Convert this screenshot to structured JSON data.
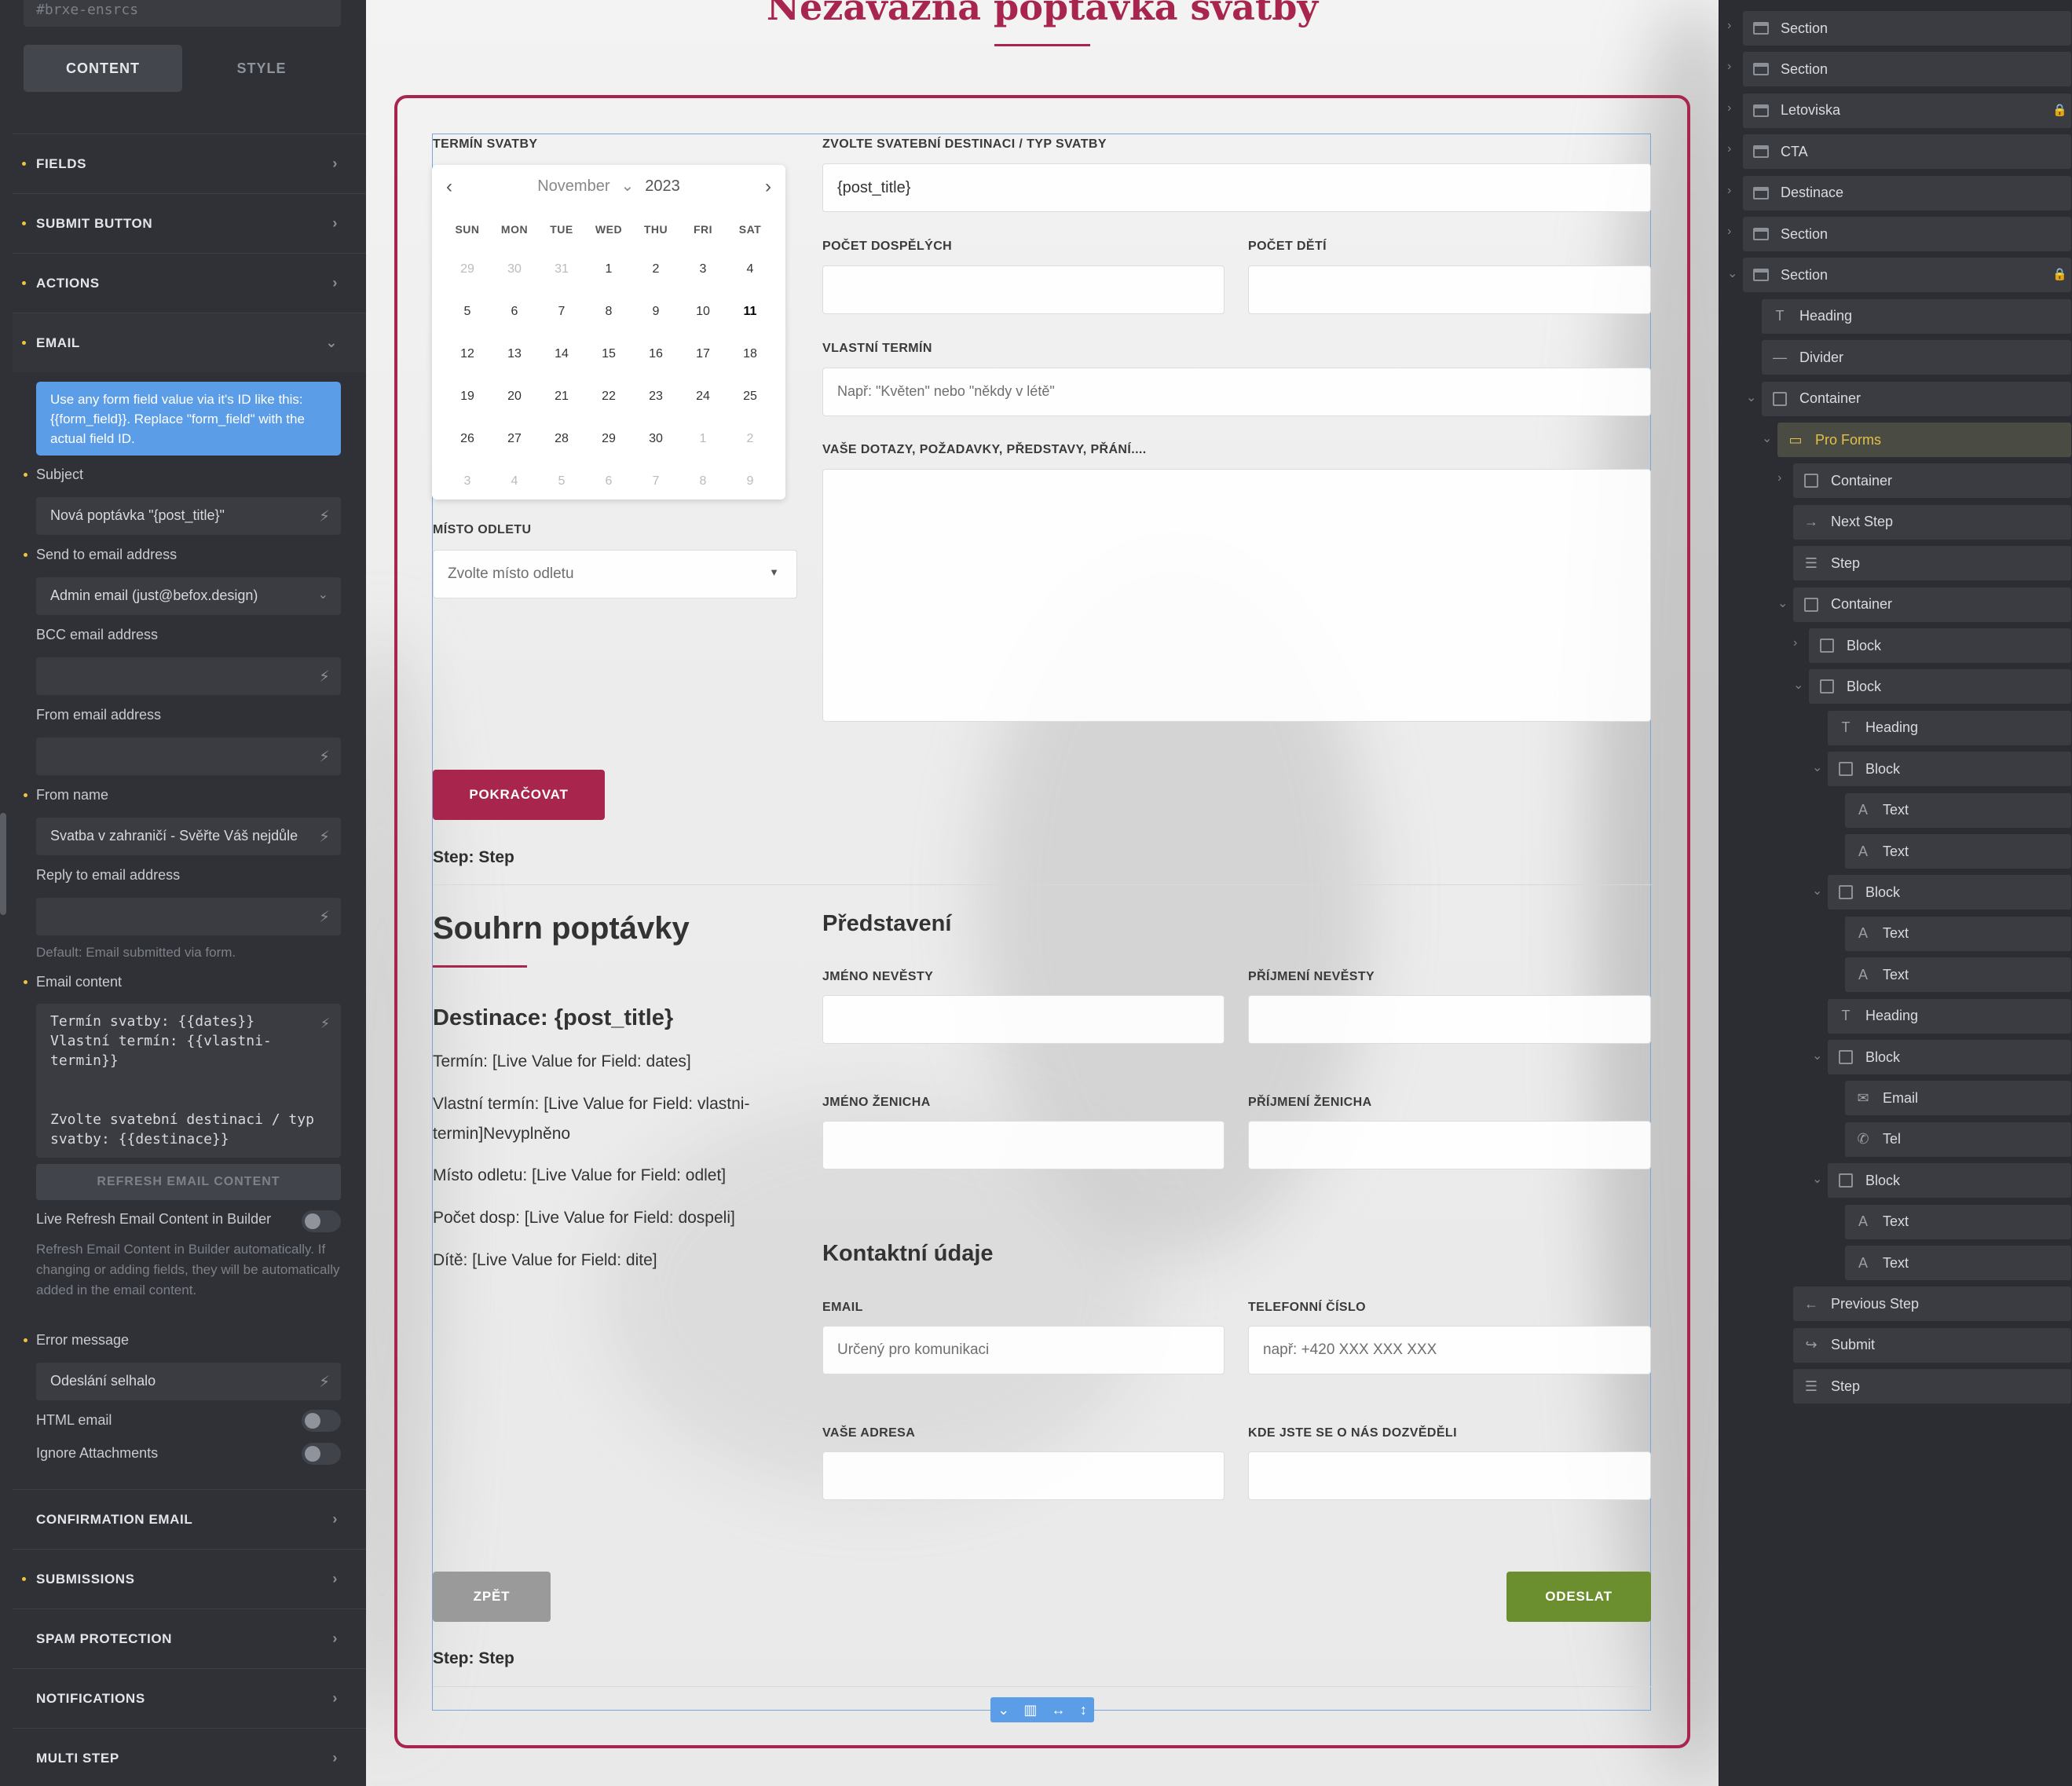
{
  "left_panel": {
    "element_id": "#brxe-ensrcs",
    "tabs": [
      "CONTENT",
      "STYLE"
    ],
    "sections": {
      "fields": "FIELDS",
      "submit_button": "SUBMIT BUTTON",
      "actions": "ACTIONS",
      "email": "EMAIL",
      "confirmation_email": "CONFIRMATION EMAIL",
      "submissions": "SUBMISSIONS",
      "spam_protection": "SPAM PROTECTION",
      "notifications": "NOTIFICATIONS",
      "multi_step": "MULTI STEP"
    },
    "email": {
      "info": "Use any form field value via it's ID like this: {{form_field}}. Replace \"form_field\" with the actual field ID.",
      "subject_label": "Subject",
      "subject_value": "Nová poptávka \"{post_title}\"",
      "send_to_label": "Send to email address",
      "send_to_value": "Admin email (just@befox.design)",
      "bcc_label": "BCC email address",
      "from_email_label": "From email address",
      "from_name_label": "From name",
      "from_name_value": "Svatba v zahraničí - Svěřte Váš nejdůle",
      "reply_to_label": "Reply to email address",
      "reply_to_hint": "Default: Email submitted via form.",
      "content_label": "Email content",
      "content_value": "Termín svatby: {{dates}}\nVlastní termín: {{vlastni-\ntermin}}\n\n\nZvolte svatební destinaci / typ\nsvatby: {{destinace}}",
      "refresh_button": "REFRESH EMAIL CONTENT",
      "live_refresh_label": "Live Refresh Email Content in Builder",
      "live_refresh_hint": "Refresh Email Content in Builder automatically. If changing or adding fields, they will be automatically added in the email content.",
      "error_label": "Error message",
      "error_value": "Odeslání selhalo",
      "html_email_label": "HTML email",
      "ignore_attachments_label": "Ignore Attachments"
    }
  },
  "canvas": {
    "page_title": "Nezávazná poptávka svatby",
    "step1": {
      "date_label": "TERMÍN SVATBY",
      "calendar": {
        "month": "November",
        "year": "2023",
        "weekdays": [
          "SUN",
          "MON",
          "TUE",
          "WED",
          "THU",
          "FRI",
          "SAT"
        ],
        "days": [
          "29",
          "30",
          "31",
          "1",
          "2",
          "3",
          "4",
          "5",
          "6",
          "7",
          "8",
          "9",
          "10",
          "11",
          "12",
          "13",
          "14",
          "15",
          "16",
          "17",
          "18",
          "19",
          "20",
          "21",
          "22",
          "23",
          "24",
          "25",
          "26",
          "27",
          "28",
          "29",
          "30",
          "1",
          "2",
          "3",
          "4",
          "5",
          "6",
          "7",
          "8",
          "9"
        ]
      },
      "departure_label": "MÍSTO ODLETU",
      "departure_value": "Zvolte místo odletu",
      "destination_label": "ZVOLTE SVATEBNÍ DESTINACI / TYP SVATBY",
      "destination_value": "{post_title}",
      "adults_label": "POČET DOSPĚLÝCH",
      "children_label": "POČET DĚTÍ",
      "custom_date_label": "VLASTNÍ TERMÍN",
      "custom_date_placeholder": "Např: \"Květen\" nebo \"někdy v létě\"",
      "questions_label": "VAŠE DOTAZY, POŽADAVKY, PŘEDSTAVY, PŘÁNÍ....",
      "continue_button": "POKRAČOVAT",
      "step_text": "Step: Step"
    },
    "summary": {
      "title": "Souhrn poptávky",
      "destination": "Destinace: {post_title}",
      "lines": [
        "Termín: [Live Value for Field: dates]",
        "Vlastní termín: [Live Value for Field: vlastni-termin]Nevyplněno",
        "Místo odletu: [Live Value for Field: odlet]",
        "Počet dosp: [Live Value for Field: dospeli]",
        "Dítě: [Live Value for Field: dite]"
      ]
    },
    "step2": {
      "intro_heading": "Představení",
      "bride_name_label": "JMÉNO NEVĚSTY",
      "bride_surname_label": "PŘÍJMENÍ NEVĚSTY",
      "groom_name_label": "JMÉNO ŽENICHA",
      "groom_surname_label": "PŘÍJMENÍ ŽENICHA",
      "contact_heading": "Kontaktní údaje",
      "email_label": "EMAIL",
      "email_placeholder": "Určený pro komunikaci",
      "phone_label": "TELEFONNÍ ČÍSLO",
      "phone_placeholder": "např: +420 XXX XXX XXX",
      "address_label": "VAŠE ADRESA",
      "source_label": "KDE JSTE SE O NÁS DOZVĚDĚLI",
      "back_button": "ZPĚT",
      "submit_button": "ODESLAT",
      "step_text": "Step: Step"
    }
  },
  "structure": {
    "nodes": [
      "Section",
      "Section",
      "Letoviska",
      "CTA",
      "Destinace",
      "Section",
      "Section",
      "Heading",
      "Divider",
      "Container",
      "Pro Forms",
      "Container",
      "Next Step",
      "Step",
      "Container",
      "Block",
      "Block",
      "Heading",
      "Block",
      "Text",
      "Text",
      "Block",
      "Text",
      "Text",
      "Heading",
      "Block",
      "Email",
      "Tel",
      "Block",
      "Text",
      "Text",
      "Previous Step",
      "Submit",
      "Step"
    ]
  },
  "colors": {
    "accent": "#a8264e",
    "submit_green": "#6b8f2f",
    "back_gray": "#9a9a9a",
    "info_blue": "#5b9de6"
  }
}
